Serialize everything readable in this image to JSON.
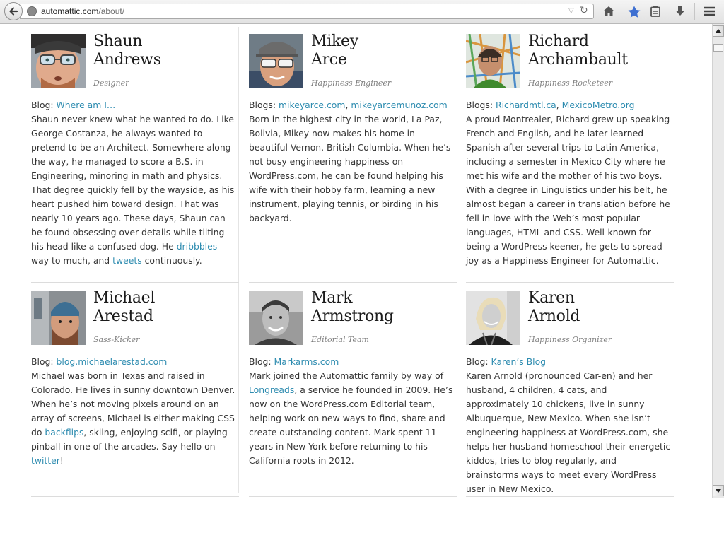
{
  "browser": {
    "url_domain": "automattic.com",
    "url_path": "/about/",
    "icons": [
      "back-arrow-icon",
      "globe-icon",
      "dropdown-icon",
      "reload-icon",
      "home-icon",
      "star-icon",
      "clipboard-icon",
      "download-icon",
      "menu-icon"
    ]
  },
  "colors": {
    "link": "#2e8cb0",
    "text": "#333333",
    "role": "#808080"
  },
  "team": [
    {
      "first": "Shaun",
      "last": "Andrews",
      "role": "Designer",
      "blog_prefix": "Blog:",
      "blog_links": [
        "Where am I…"
      ],
      "blog_sep": "",
      "bio1": "Shaun never knew what he wanted to do. Like George Costanza, he always wanted to pretend to be an Architect. Somewhere along the way, he managed to score a B.S. in Engineering, minoring in math and physics. That degree quickly fell by the wayside, as his heart pushed him toward design. That was nearly 10 years ago. These days, Shaun can be found obsessing over details while tilting his head like a confused dog. He ",
      "link1": "dribbbles",
      "bio2": " way to much, and ",
      "link2": "tweets",
      "bio3": " continuously."
    },
    {
      "first": "Mikey",
      "last": "Arce",
      "role": "Happiness Engineer",
      "blog_prefix": "Blogs:",
      "blog_links": [
        "mikeyarce.com",
        "mikeyarcemunoz.com"
      ],
      "blog_sep": ", ",
      "bio1": "Born in the highest city in the world, La Paz, Bolivia, Mikey now makes his home in beautiful Vernon, British Columbia. When he’s not busy engineering happiness on WordPress.com, he can be found helping his wife with their hobby farm, learning a new instrument, playing tennis, or birding in his backyard."
    },
    {
      "first": "Richard",
      "last": "Archambault",
      "role": "Happiness Rocketeer",
      "blog_prefix": "Blogs:",
      "blog_links": [
        "Richardmtl.ca",
        "MexicoMetro.org"
      ],
      "blog_sep": ", ",
      "bio1": "A proud Montrealer, Richard grew up speaking French and English, and he later learned Spanish after several trips to Latin America, including a semester in Mexico City where he met his wife and the mother of his two boys. With a degree in Linguistics under his belt, he almost began a career in translation before he fell in love with the Web’s most popular languages, HTML and CSS. Well-known for being a WordPress keener, he gets to spread joy as a Happiness Engineer for Automattic."
    },
    {
      "first": "Michael",
      "last": "Arestad",
      "role": "Sass-Kicker",
      "blog_prefix": "Blog:",
      "blog_links": [
        "blog.michaelarestad.com"
      ],
      "blog_sep": "",
      "bio1": "Michael was born in Texas and raised in Colorado. He lives in sunny downtown Denver. When he’s not moving pixels around on an array of screens, Michael is either making CSS do ",
      "link1": "backflips",
      "bio2": ", skiing, enjoying scifi, or playing pinball in one of the arcades. Say hello on ",
      "link2": "twitter",
      "bio3": "!"
    },
    {
      "first": "Mark",
      "last": "Armstrong",
      "role": "Editorial Team",
      "blog_prefix": "Blog:",
      "blog_links": [
        "Markarms.com"
      ],
      "blog_sep": "",
      "bio1": "Mark joined the Automattic family by way of ",
      "link1": "Longreads",
      "bio2": ", a service he founded in 2009. He’s now on the WordPress.com Editorial team, helping work on new ways to find, share and create outstanding content. Mark spent 11 years in New York before returning to his California roots in 2012."
    },
    {
      "first": "Karen",
      "last": "Arnold",
      "role": "Happiness Organizer",
      "blog_prefix": "Blog:",
      "blog_links": [
        "Karen’s Blog"
      ],
      "blog_sep": "",
      "bio1": "Karen Arnold (pronounced Car-en) and her husband, 4 children, 4 cats, and approximately 10 chickens, live in sunny Albuquerque, New Mexico. When she isn’t engineering happiness at WordPress.com, she helps her husband homeschool their energetic kiddos, tries to blog regularly, and brainstorms ways to meet every WordPress user in New Mexico."
    }
  ]
}
